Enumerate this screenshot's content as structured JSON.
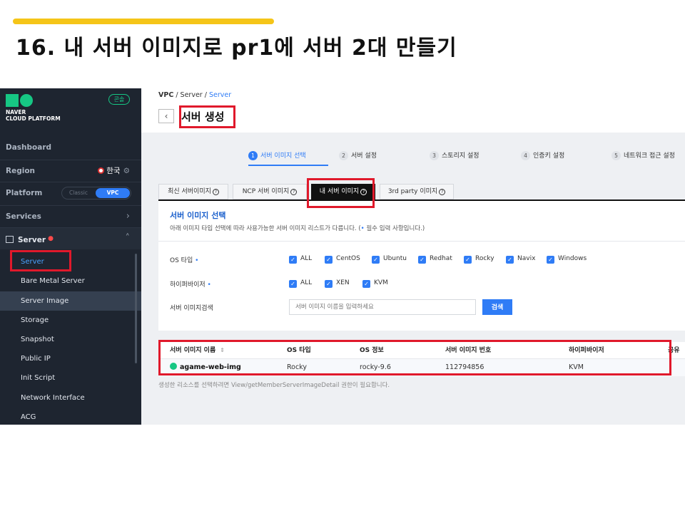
{
  "slide": {
    "title": "16. 내 서버 이미지로 pr1에 서버 2대 만들기",
    "accent_color": "#f5c518"
  },
  "sidebar": {
    "logo_line1": "NAVER",
    "logo_line2": "CLOUD PLATFORM",
    "console_badge": "콘솔",
    "dashboard": "Dashboard",
    "region_label": "Region",
    "region_value": "한국",
    "platform_label": "Platform",
    "platform_classic": "Classic",
    "platform_vpc": "VPC",
    "services_label": "Services",
    "server_group": "Server",
    "items": [
      {
        "label": "Server"
      },
      {
        "label": "Bare Metal Server"
      },
      {
        "label": "Server Image"
      },
      {
        "label": "Storage"
      },
      {
        "label": "Snapshot"
      },
      {
        "label": "Public IP"
      },
      {
        "label": "Init Script"
      },
      {
        "label": "Network Interface"
      },
      {
        "label": "ACG"
      }
    ]
  },
  "breadcrumb": {
    "root": "VPC",
    "sep1": " / ",
    "middle": "Server",
    "sep2": " / ",
    "current": "Server"
  },
  "page_title": "서버 생성",
  "steps": [
    {
      "num": "1",
      "label": "서버 이미지 선택"
    },
    {
      "num": "2",
      "label": "서버 설정"
    },
    {
      "num": "3",
      "label": "스토리지 설정"
    },
    {
      "num": "4",
      "label": "인증키 설정"
    },
    {
      "num": "5",
      "label": "네트워크 접근 설정"
    }
  ],
  "tabs": [
    {
      "label": "최신 서버이미지"
    },
    {
      "label": "NCP 서버 이미지"
    },
    {
      "label": "내 서버 이미지"
    },
    {
      "label": "3rd party 이미지"
    }
  ],
  "panel": {
    "title": "서버 이미지 선택",
    "desc_main": "아래 이미지 타입 선택에 따라 사용가능한 서버 이미지 리스트가 다릅니다. (",
    "desc_required": " 필수 입력 사항입니다.)",
    "os_label": "OS 타입",
    "os_options": [
      "ALL",
      "CentOS",
      "Ubuntu",
      "Redhat",
      "Rocky",
      "Navix",
      "Windows"
    ],
    "hv_label": "하이퍼바이저",
    "hv_options": [
      "ALL",
      "XEN",
      "KVM"
    ],
    "search_label": "서버 이미지검색",
    "search_placeholder": "서버 이미지 이름을 입력하세요",
    "search_button": "검색"
  },
  "table": {
    "headers": [
      "서버 이미지 이름",
      "OS 타입",
      "OS 정보",
      "서버 이미지 번호",
      "하이퍼바이저",
      "공유"
    ],
    "rows": [
      {
        "name": "agame-web-img",
        "os_type": "Rocky",
        "os_info": "rocky-9.6",
        "number": "112794856",
        "hypervisor": "KVM"
      }
    ]
  },
  "footnote": "생성한 리소스를 선택하려면 View/getMemberServerImageDetail 권한이 필요합니다.",
  "highlight_color": "#e0192b"
}
